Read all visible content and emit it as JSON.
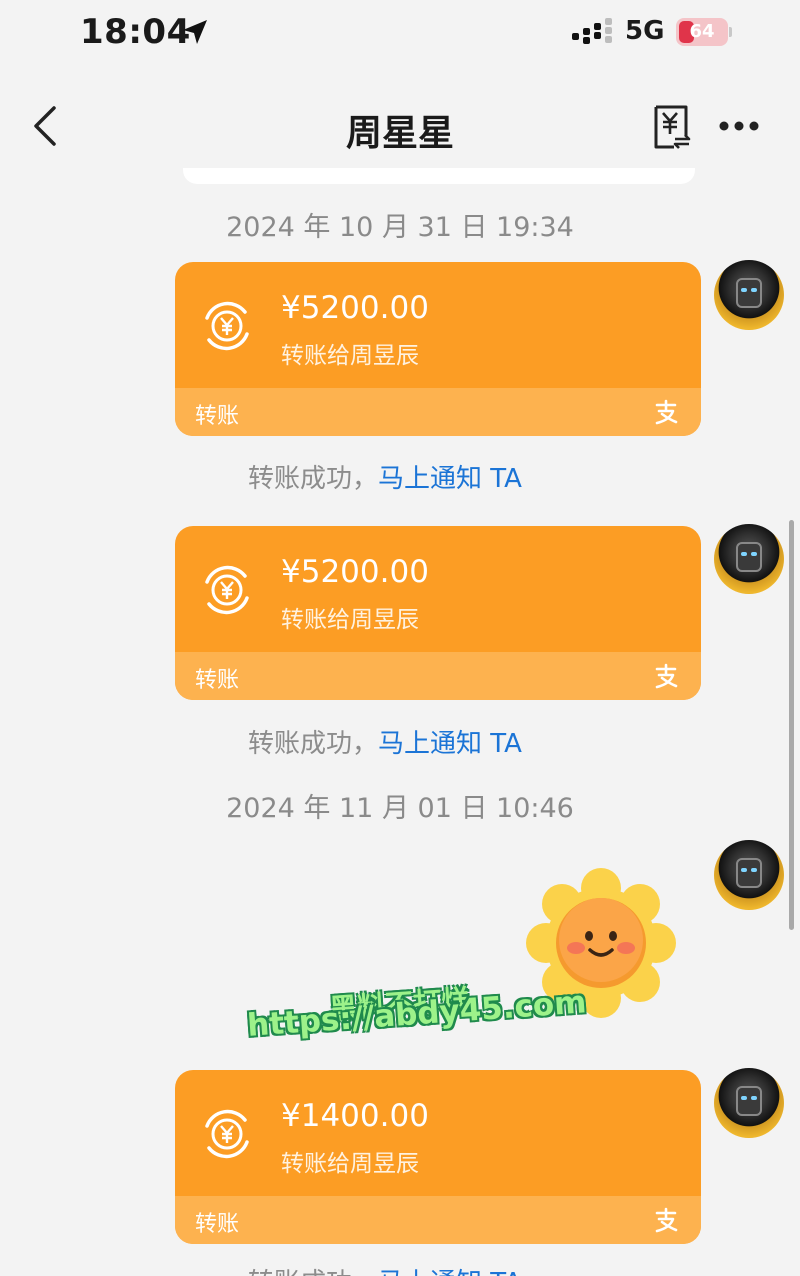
{
  "status_bar": {
    "time": "18:04",
    "network": "5G",
    "battery": "64"
  },
  "nav": {
    "title": "周星星"
  },
  "chat": {
    "timestamps": [
      "2024 年 10 月 31 日 19:34",
      "2024 年 11 月 01 日 10:46"
    ],
    "transfers": [
      {
        "amount": "¥5200.00",
        "desc": "转账给周昱辰",
        "footer": "转账"
      },
      {
        "amount": "¥5200.00",
        "desc": "转账给周昱辰",
        "footer": "转账"
      },
      {
        "amount": "¥1400.00",
        "desc": "转账给周昱辰",
        "footer": "转账"
      }
    ],
    "status": {
      "text": "转账成功，",
      "link": "马上通知 TA"
    }
  },
  "watermark": {
    "line1": "黑料不打烊",
    "line2": "https://abdy45.com"
  },
  "colors": {
    "card": "#fc9d24",
    "card_footer": "#fdb24f",
    "link": "#1b74d6"
  }
}
